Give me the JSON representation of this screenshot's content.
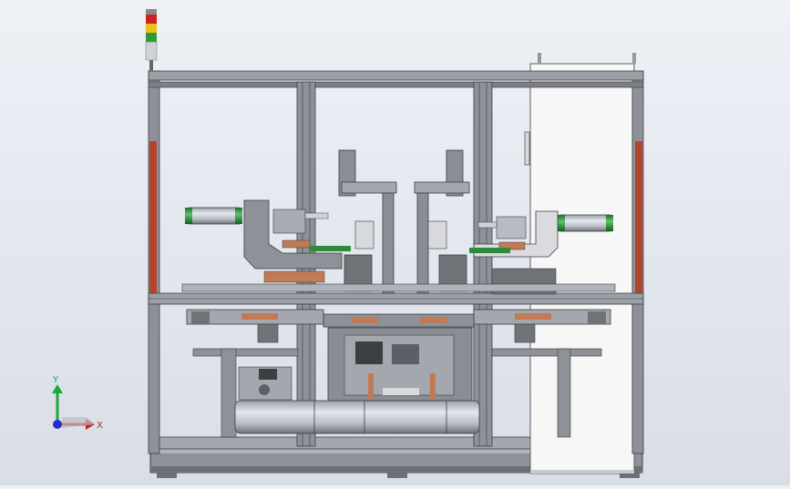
{
  "viewport": {
    "background_top": "#eef1f6",
    "background_bottom": "#d9dde6"
  },
  "machine": {
    "frame_color": "#8e9298",
    "frame_dark": "#3a3d42",
    "guard_red": "#b4442c",
    "copper": "#c27a55",
    "cabinet_white": "#f7f7f7",
    "cylinder_green": "#2f8a3a"
  },
  "signal_tower": {
    "lights": [
      "#d21f1f",
      "#e8c21a",
      "#2e9b3a"
    ]
  },
  "triad": {
    "x_label": "X",
    "y_label": "Y",
    "x_color": "#d01e1e",
    "y_color": "#1ea83a",
    "z_color": "#2a2ad0",
    "x_icon": "x-axis-arrow-icon",
    "y_icon": "y-axis-arrow-icon",
    "z_icon": "z-axis-dot-icon"
  }
}
